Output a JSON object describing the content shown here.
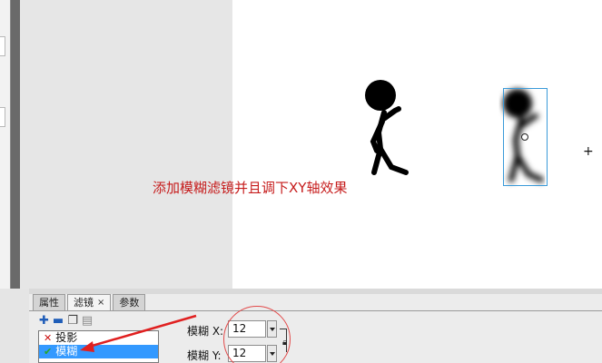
{
  "annotation": {
    "text": "添加模糊滤镜并且调下XY轴效果",
    "color": "#c61c1c"
  },
  "panel": {
    "tabs": [
      {
        "label": "属性",
        "active": false
      },
      {
        "label": "滤镜",
        "active": true,
        "close": "×"
      },
      {
        "label": "参数",
        "active": false
      }
    ],
    "toolbar_icons": [
      "add-filter-icon",
      "remove-filter-icon",
      "copy-filter-icon",
      "paste-filter-icon"
    ],
    "filters": [
      {
        "label": "投影",
        "state": "disabled",
        "mark": "✕"
      },
      {
        "label": "模糊",
        "state": "enabled",
        "mark": "✔",
        "selected": true
      }
    ],
    "blur_x": {
      "label": "模糊 X:",
      "value": "12"
    },
    "blur_y": {
      "label": "模糊 Y:",
      "value": "12"
    }
  },
  "colors": {
    "stage": "#ffffff",
    "pasteboard": "#e6e6e6",
    "selection": "#3a9ad9",
    "list_selected": "#3399ff"
  }
}
